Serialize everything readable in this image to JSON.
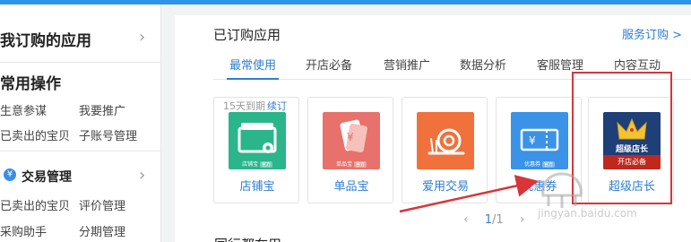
{
  "sidebar": {
    "my_apps_title": "我订购的应用",
    "common_ops_title": "常用操作",
    "common_links": [
      "生意参谋",
      "我要推广",
      "已卖出的宝贝",
      "子账号管理"
    ],
    "trade_title": "交易管理",
    "trade_icon_glyph": "¥",
    "trade_links": [
      "已卖出的宝贝",
      "评价管理",
      "采购助手",
      "分期管理"
    ],
    "chevron": "›"
  },
  "main": {
    "title": "已订购应用",
    "service_link": "服务订购 >",
    "tabs": [
      {
        "label": "最常使用",
        "active": true
      },
      {
        "label": "开店必备",
        "active": false
      },
      {
        "label": "营销推广",
        "active": false
      },
      {
        "label": "数据分析",
        "active": false
      },
      {
        "label": "客服管理",
        "active": false
      },
      {
        "label": "内容互动",
        "active": false
      }
    ],
    "apps": [
      {
        "name": "店铺宝",
        "thumb_label": "店铺宝",
        "official": "官方",
        "color": "#2ab58a",
        "expiry": "15天到期",
        "renew": "续订"
      },
      {
        "name": "单品宝",
        "thumb_label": "单品宝",
        "official": "官方",
        "color": "#e8716b"
      },
      {
        "name": "爱用交易",
        "color": "#f0713c"
      },
      {
        "name": "优惠券",
        "thumb_label": "优惠券",
        "official": "官方",
        "color": "#3a93e6"
      },
      {
        "name": "超级店长",
        "crown_text": "超级店长",
        "band_text": "开店必备",
        "color": "#1e3f78"
      }
    ],
    "pagination": {
      "prev": "‹",
      "current": "1",
      "total": "/1",
      "next": "›"
    },
    "next_section_title": "同行都在用"
  },
  "colors": {
    "accent": "#2f7dd1",
    "highlight_box": "#d9343a",
    "arrow": "#d9343a"
  },
  "watermark": {
    "text": "jingyan.baidu.com"
  }
}
